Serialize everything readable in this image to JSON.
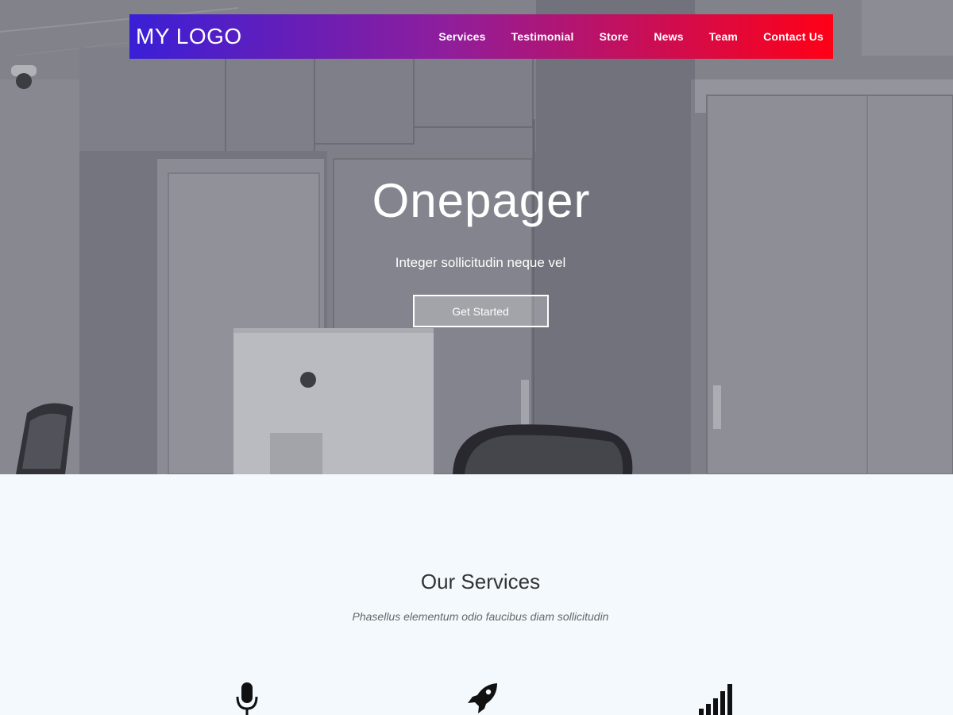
{
  "navbar": {
    "logo": "MY LOGO",
    "gradient_start": "#3a1fd6",
    "gradient_end": "#ff0016",
    "links": [
      "Services",
      "Testimonial",
      "Store",
      "News",
      "Team",
      "Contact Us"
    ]
  },
  "hero": {
    "title": "Onepager",
    "subtitle": "Integer sollicitudin neque vel",
    "cta_label": "Get Started"
  },
  "services": {
    "title": "Our Services",
    "subtitle": "Phasellus elementum odio faucibus diam sollicitudin",
    "icons": [
      "microphone-icon",
      "rocket-icon",
      "signal-bars-icon"
    ]
  }
}
